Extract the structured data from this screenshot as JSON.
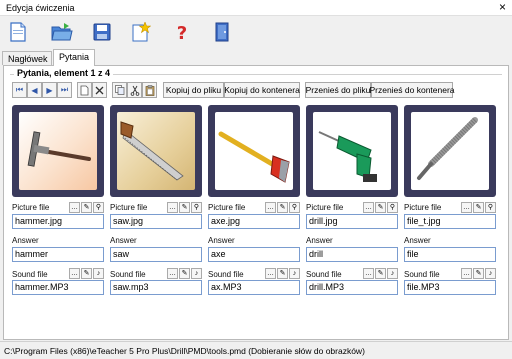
{
  "window": {
    "title": "Edycja ćwiczenia",
    "close_symbol": "×"
  },
  "toolbar": {
    "icons": [
      "new-document-icon",
      "open-folder-icon",
      "save-icon",
      "new-star-icon",
      "help-icon",
      "exit-icon"
    ]
  },
  "tabs": [
    {
      "label": "Nagłówek",
      "active": false
    },
    {
      "label": "Pytania",
      "active": true
    }
  ],
  "panel": {
    "group_label": "Pytania, element 1 z 4",
    "nav": {
      "first": "⏮",
      "prev": "◀",
      "next": "▶",
      "last": "⏭",
      "copy_to_file": "Kopiuj do pliku",
      "copy_to_container": "Kopiuj do kontenera",
      "move_to_file": "Przenieś do pliku",
      "move_to_container": "Przenieś do kontenera"
    },
    "field_labels": {
      "picture": "Picture file",
      "answer": "Answer",
      "sound": "Sound file"
    },
    "items": [
      {
        "picture_file": "hammer.jpg",
        "answer": "hammer",
        "sound_file": "hammer.MP3"
      },
      {
        "picture_file": "saw.jpg",
        "answer": "saw",
        "sound_file": "saw.mp3"
      },
      {
        "picture_file": "axe.jpg",
        "answer": "axe",
        "sound_file": "ax.MP3"
      },
      {
        "picture_file": "drill.jpg",
        "answer": "drill",
        "sound_file": "drill.MP3"
      },
      {
        "picture_file": "file_t.jpg",
        "answer": "file",
        "sound_file": "file.MP3"
      }
    ]
  },
  "statusbar": {
    "path": "C:\\Program Files (x86)\\eTeacher 5 Pro Plus\\Drill\\PMD\\tools.pmd (Dobieranie słów do obrazków)"
  },
  "colors": {
    "frame": "#3a3a5c",
    "field_border": "#7a9ccf",
    "nav_accent": "#2f56a8"
  }
}
